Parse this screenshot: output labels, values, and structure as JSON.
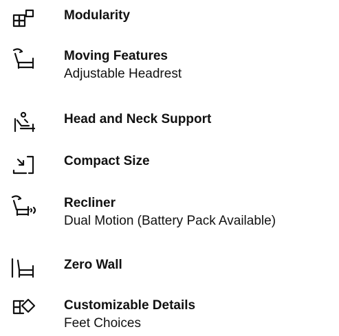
{
  "features": [
    {
      "icon": "modularity-icon",
      "title": "Modularity",
      "subtitle": ""
    },
    {
      "icon": "moving-headrest-icon",
      "title": "Moving Features",
      "subtitle": "Adjustable Headrest"
    },
    {
      "icon": "head-neck-support-icon",
      "title": "Head and Neck Support",
      "subtitle": ""
    },
    {
      "icon": "compact-size-icon",
      "title": "Compact Size",
      "subtitle": ""
    },
    {
      "icon": "recliner-icon",
      "title": "Recliner",
      "subtitle": "Dual Motion (Battery Pack Available)"
    },
    {
      "icon": "zero-wall-icon",
      "title": "Zero Wall",
      "subtitle": ""
    },
    {
      "icon": "customizable-details-icon",
      "title": "Customizable Details",
      "subtitle": "Feet Choices"
    }
  ]
}
